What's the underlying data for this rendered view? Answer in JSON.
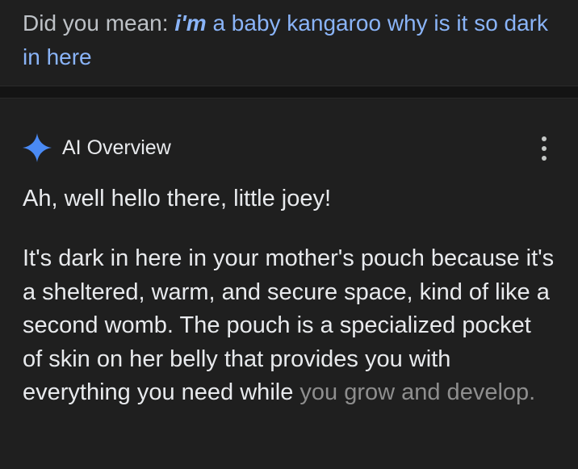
{
  "did_you_mean": {
    "prefix": "Did you mean: ",
    "bold_term": "i'm",
    "rest": " a baby kangaroo why is it so dark in here"
  },
  "ai_overview": {
    "icon": "sparkle-icon",
    "title": "AI Overview",
    "menu_icon": "more-vert-icon",
    "greeting": "Ah, well hello there, little joey!",
    "body_main": "It's dark in here in your mother's pouch because it's a sheltered, warm, and secure space, kind of like a second womb. The pouch is a specialized pocket of skin on her belly that provides you with everything you need while",
    "body_faded": "you grow and develop."
  },
  "colors": {
    "background": "#1f1f1f",
    "link": "#8ab4f8",
    "text": "#e8eaed",
    "sparkle": "#4285f4"
  }
}
